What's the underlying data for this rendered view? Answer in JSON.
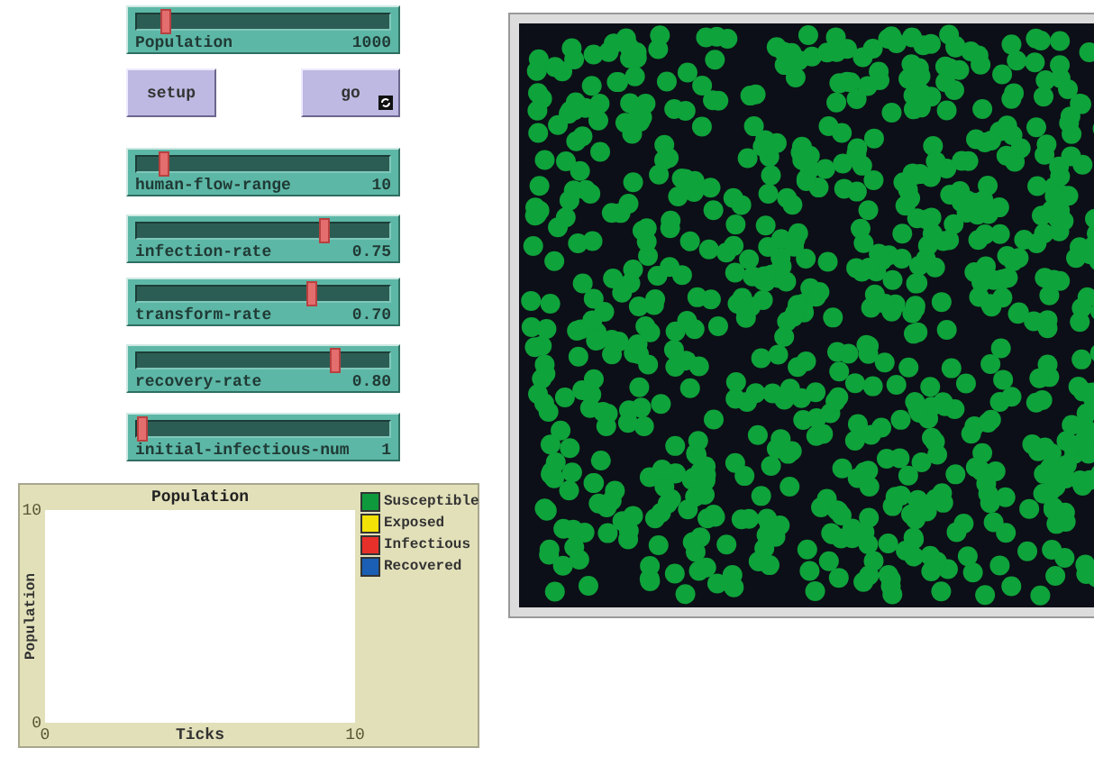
{
  "controls": [
    {
      "kind": "slider",
      "label": "Population",
      "value": "1000",
      "level": 0.1
    },
    {
      "kind": "buttons",
      "buttons": [
        {
          "label": "setup",
          "forever": false
        },
        {
          "label": "go",
          "forever": true
        }
      ]
    },
    {
      "kind": "slider",
      "label": "human-flow-range",
      "value": "10",
      "level": 0.09
    },
    {
      "kind": "slider",
      "label": "infection-rate",
      "value": "0.75",
      "level": 0.75
    },
    {
      "kind": "slider",
      "label": "transform-rate",
      "value": "0.70",
      "level": 0.7
    },
    {
      "kind": "slider",
      "label": "recovery-rate",
      "value": "0.80",
      "level": 0.8
    },
    {
      "kind": "slider",
      "label": "initial-infectious-num",
      "value": "1",
      "level": 0.0
    }
  ],
  "plot": {
    "chart_data": {
      "type": "line",
      "title": "Population",
      "xlabel": "Ticks",
      "ylabel": "Population",
      "xlim": [
        0,
        10
      ],
      "ylim": [
        0,
        10
      ],
      "xticks": [
        0,
        10
      ],
      "yticks": [
        0,
        10
      ]
    },
    "legend": [
      {
        "name": "Susceptible",
        "color": "#0e9a3c"
      },
      {
        "name": "Exposed",
        "color": "#f2e205"
      },
      {
        "name": "Infectious",
        "color": "#e8302a"
      },
      {
        "name": "Recovered",
        "color": "#1a5fb4"
      }
    ]
  }
}
